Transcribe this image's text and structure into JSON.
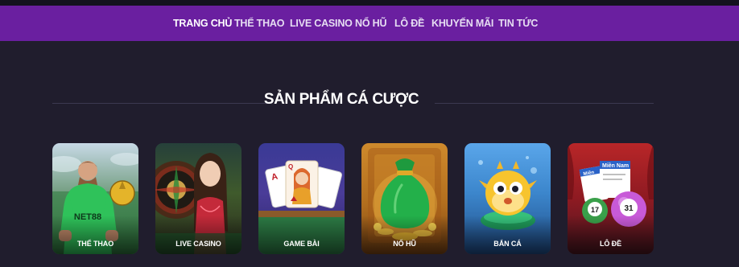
{
  "nav": {
    "items": [
      {
        "label": "TRANG CHỦ",
        "active": true
      },
      {
        "label": "THỂ THAO",
        "active": false
      },
      {
        "label": "LIVE CASINO",
        "active": false
      },
      {
        "label": "NỔ HŨ",
        "active": false
      },
      {
        "label": "LÔ ĐỀ",
        "active": false
      },
      {
        "label": "KHUYẾN MÃI",
        "active": false
      },
      {
        "label": "TIN TỨC",
        "active": false
      }
    ]
  },
  "section": {
    "title": "SẢN PHẨM CÁ CƯỢC"
  },
  "products": [
    {
      "label": "THỂ THAO",
      "icon": "soccer-player-icon"
    },
    {
      "label": "LIVE CASINO",
      "icon": "roulette-dealer-icon"
    },
    {
      "label": "GAME BÀI",
      "icon": "playing-cards-icon"
    },
    {
      "label": "NỔ HŨ",
      "icon": "money-bag-icon"
    },
    {
      "label": "BẮN CÁ",
      "icon": "pufferfish-icon"
    },
    {
      "label": "LÔ ĐỀ",
      "icon": "lottery-balls-icon"
    }
  ],
  "card_art": {
    "jersey_text": "NET88",
    "ticket_text_1": "Miền",
    "ticket_text_2": "Miền Nam",
    "ball_1": "17",
    "ball_2": "31"
  },
  "colors": {
    "background": "#201d2d",
    "nav_bar": "#6a1fa0",
    "nav_text": "#e6ddf2",
    "title_text": "#ffffff",
    "divider": "#3b3850"
  }
}
